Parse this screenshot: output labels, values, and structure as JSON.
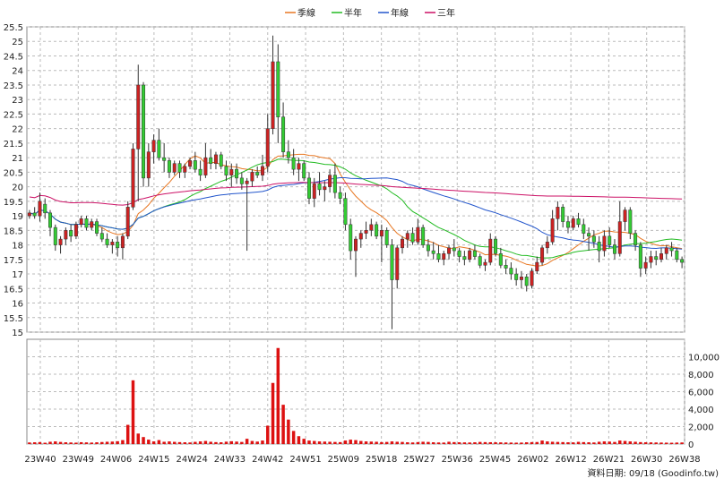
{
  "chart_data": {
    "type": "candlestick",
    "legend": [
      {
        "name": "季線",
        "color": "#e87722"
      },
      {
        "name": "半年",
        "color": "#22bb22"
      },
      {
        "name": "年線",
        "color": "#2255cc"
      },
      {
        "name": "三年",
        "color": "#cc1166"
      }
    ],
    "legend_position": "top-center",
    "grid": true,
    "price_axis": {
      "ylim": [
        15,
        25.5
      ],
      "ticks": [
        "15",
        "15.5",
        "16",
        "16.5",
        "17",
        "17.5",
        "18",
        "18.5",
        "19",
        "19.5",
        "20",
        "20.5",
        "21",
        "21.5",
        "22",
        "22.5",
        "23",
        "23.5",
        "24",
        "24.5",
        "25",
        "25.5"
      ]
    },
    "volume_axis": {
      "ylim": [
        0,
        12000
      ],
      "ticks": [
        "0",
        "2,000",
        "4,000",
        "6,000",
        "8,000",
        "10,000"
      ]
    },
    "x_ticks": [
      "23W40",
      "23W49",
      "24W06",
      "24W15",
      "24W24",
      "24W33",
      "24W42",
      "24W51",
      "25W09",
      "25W18",
      "25W27",
      "25W36",
      "25W45",
      "26W02",
      "26W12",
      "26W21",
      "26W30",
      "26W38"
    ],
    "footnote": "資料日期: 09/18  (Goodinfo.tw)",
    "up_color": "#cc2222",
    "down_color": "#33cc33",
    "candles": [
      [
        19.0,
        19.2,
        18.9,
        19.1
      ],
      [
        19.1,
        19.3,
        18.9,
        19.0
      ],
      [
        19.0,
        19.8,
        18.8,
        19.5
      ],
      [
        19.4,
        19.6,
        18.9,
        19.1
      ],
      [
        19.1,
        19.2,
        18.3,
        18.6
      ],
      [
        18.6,
        18.7,
        17.8,
        18.0
      ],
      [
        18.0,
        18.3,
        17.7,
        18.2
      ],
      [
        18.2,
        18.6,
        18.0,
        18.5
      ],
      [
        18.5,
        18.7,
        18.1,
        18.3
      ],
      [
        18.3,
        18.8,
        18.2,
        18.7
      ],
      [
        18.7,
        19.0,
        18.6,
        18.9
      ],
      [
        18.9,
        19.0,
        18.5,
        18.6
      ],
      [
        18.6,
        18.9,
        18.5,
        18.8
      ],
      [
        18.8,
        18.9,
        18.3,
        18.4
      ],
      [
        18.4,
        18.6,
        18.1,
        18.2
      ],
      [
        18.2,
        18.4,
        17.9,
        18.0
      ],
      [
        18.0,
        18.2,
        17.7,
        18.1
      ],
      [
        18.1,
        18.3,
        17.6,
        17.9
      ],
      [
        17.9,
        18.4,
        17.5,
        18.3
      ],
      [
        18.3,
        19.5,
        18.2,
        19.3
      ],
      [
        19.3,
        21.5,
        19.2,
        21.3
      ],
      [
        21.3,
        24.2,
        19.5,
        23.5
      ],
      [
        23.5,
        23.6,
        20.0,
        20.3
      ],
      [
        20.3,
        21.5,
        20.0,
        21.2
      ],
      [
        21.2,
        21.8,
        20.8,
        21.6
      ],
      [
        21.6,
        22.0,
        20.9,
        21.0
      ],
      [
        21.0,
        21.5,
        20.5,
        20.9
      ],
      [
        20.9,
        21.0,
        20.3,
        20.5
      ],
      [
        20.5,
        20.9,
        20.4,
        20.8
      ],
      [
        20.8,
        20.9,
        20.3,
        20.5
      ],
      [
        20.5,
        20.8,
        20.3,
        20.7
      ],
      [
        20.7,
        21.0,
        20.6,
        20.9
      ],
      [
        20.9,
        21.2,
        20.5,
        20.6
      ],
      [
        20.6,
        20.9,
        20.2,
        20.4
      ],
      [
        20.4,
        21.5,
        20.3,
        21.0
      ],
      [
        21.0,
        21.3,
        20.6,
        20.8
      ],
      [
        20.8,
        21.2,
        20.6,
        21.1
      ],
      [
        21.1,
        21.2,
        20.6,
        20.7
      ],
      [
        20.7,
        20.9,
        20.2,
        20.4
      ],
      [
        20.4,
        20.8,
        20.0,
        20.6
      ],
      [
        20.6,
        20.8,
        20.1,
        20.3
      ],
      [
        20.3,
        20.5,
        19.9,
        20.1
      ],
      [
        20.1,
        20.3,
        17.8,
        20.2
      ],
      [
        20.2,
        20.6,
        20.0,
        20.5
      ],
      [
        20.5,
        20.7,
        20.3,
        20.4
      ],
      [
        20.4,
        21.1,
        20.2,
        20.7
      ],
      [
        20.7,
        22.5,
        20.5,
        22.0
      ],
      [
        22.0,
        25.2,
        21.8,
        24.3
      ],
      [
        24.3,
        24.9,
        21.5,
        22.4
      ],
      [
        22.4,
        22.9,
        21.0,
        21.2
      ],
      [
        21.2,
        21.6,
        20.8,
        21.0
      ],
      [
        21.0,
        21.3,
        20.4,
        20.6
      ],
      [
        20.6,
        21.0,
        20.2,
        20.8
      ],
      [
        20.8,
        20.9,
        20.2,
        20.3
      ],
      [
        20.3,
        20.5,
        19.4,
        19.6
      ],
      [
        19.6,
        20.3,
        19.3,
        20.1
      ],
      [
        20.1,
        20.5,
        19.7,
        19.9
      ],
      [
        19.9,
        20.2,
        19.5,
        20.0
      ],
      [
        20.0,
        20.6,
        19.8,
        20.4
      ],
      [
        20.4,
        20.8,
        19.6,
        19.8
      ],
      [
        19.8,
        20.0,
        19.4,
        19.6
      ],
      [
        19.6,
        19.8,
        18.5,
        18.7
      ],
      [
        18.7,
        18.9,
        17.5,
        17.8
      ],
      [
        17.8,
        18.3,
        16.9,
        18.2
      ],
      [
        18.2,
        18.5,
        17.9,
        18.4
      ],
      [
        18.4,
        18.8,
        18.2,
        18.5
      ],
      [
        18.5,
        18.9,
        18.3,
        18.7
      ],
      [
        18.7,
        18.8,
        18.2,
        18.3
      ],
      [
        18.3,
        18.7,
        17.4,
        18.5
      ],
      [
        18.5,
        18.6,
        17.9,
        18.0
      ],
      [
        18.0,
        18.2,
        15.1,
        16.8
      ],
      [
        16.8,
        18.0,
        16.5,
        17.9
      ],
      [
        17.9,
        18.3,
        17.7,
        18.2
      ],
      [
        18.2,
        18.5,
        17.9,
        18.4
      ],
      [
        18.4,
        18.6,
        18.0,
        18.1
      ],
      [
        18.1,
        18.9,
        18.0,
        18.6
      ],
      [
        18.6,
        18.7,
        17.9,
        18.0
      ],
      [
        18.0,
        18.2,
        17.6,
        17.8
      ],
      [
        17.8,
        18.1,
        17.5,
        17.7
      ],
      [
        17.7,
        18.0,
        17.4,
        17.5
      ],
      [
        17.5,
        17.8,
        17.3,
        17.7
      ],
      [
        17.7,
        18.0,
        17.5,
        17.9
      ],
      [
        17.9,
        18.2,
        17.6,
        17.8
      ],
      [
        17.8,
        17.9,
        17.4,
        17.6
      ],
      [
        17.6,
        17.8,
        17.3,
        17.5
      ],
      [
        17.5,
        17.9,
        17.4,
        17.8
      ],
      [
        17.8,
        18.0,
        17.5,
        17.6
      ],
      [
        17.6,
        17.7,
        17.2,
        17.3
      ],
      [
        17.3,
        17.5,
        17.1,
        17.4
      ],
      [
        17.4,
        18.4,
        17.3,
        18.2
      ],
      [
        18.2,
        18.3,
        17.6,
        17.7
      ],
      [
        17.7,
        17.9,
        17.2,
        17.3
      ],
      [
        17.3,
        17.5,
        17.0,
        17.2
      ],
      [
        17.2,
        17.4,
        16.8,
        17.0
      ],
      [
        17.0,
        17.2,
        16.6,
        16.8
      ],
      [
        16.8,
        17.1,
        16.5,
        16.9
      ],
      [
        16.9,
        17.0,
        16.4,
        16.6
      ],
      [
        16.6,
        17.2,
        16.5,
        17.1
      ],
      [
        17.1,
        17.6,
        17.0,
        17.4
      ],
      [
        17.4,
        18.0,
        17.3,
        17.9
      ],
      [
        17.9,
        18.3,
        17.7,
        18.1
      ],
      [
        18.1,
        19.2,
        18.0,
        18.9
      ],
      [
        18.9,
        19.5,
        18.5,
        19.3
      ],
      [
        19.3,
        19.4,
        18.6,
        18.8
      ],
      [
        18.8,
        19.0,
        18.4,
        18.6
      ],
      [
        18.6,
        19.0,
        18.5,
        18.9
      ],
      [
        18.9,
        19.1,
        18.6,
        18.7
      ],
      [
        18.7,
        18.9,
        18.2,
        18.4
      ],
      [
        18.4,
        18.6,
        17.8,
        18.3
      ],
      [
        18.3,
        18.5,
        17.9,
        18.1
      ],
      [
        18.1,
        18.3,
        17.4,
        17.8
      ],
      [
        17.8,
        18.5,
        17.6,
        18.3
      ],
      [
        18.3,
        18.6,
        17.9,
        18.0
      ],
      [
        18.0,
        18.2,
        17.5,
        17.7
      ],
      [
        17.7,
        19.5,
        17.6,
        18.8
      ],
      [
        18.8,
        19.3,
        18.5,
        19.2
      ],
      [
        19.2,
        19.3,
        18.2,
        18.4
      ],
      [
        18.4,
        18.5,
        17.8,
        18.0
      ],
      [
        18.0,
        18.1,
        16.9,
        17.2
      ],
      [
        17.2,
        17.6,
        17.0,
        17.4
      ],
      [
        17.4,
        17.8,
        17.2,
        17.6
      ],
      [
        17.6,
        17.8,
        17.3,
        17.5
      ],
      [
        17.5,
        17.9,
        17.4,
        17.7
      ],
      [
        17.7,
        18.0,
        17.5,
        17.9
      ],
      [
        17.9,
        18.1,
        17.6,
        17.8
      ],
      [
        17.8,
        17.9,
        17.4,
        17.5
      ],
      [
        17.5,
        17.6,
        17.2,
        17.4
      ]
    ],
    "volumes": [
      180,
      200,
      220,
      150,
      260,
      300,
      240,
      200,
      180,
      160,
      210,
      190,
      170,
      200,
      230,
      260,
      280,
      320,
      450,
      2200,
      7300,
      1200,
      800,
      500,
      300,
      450,
      260,
      300,
      250,
      220,
      200,
      180,
      250,
      300,
      350,
      260,
      220,
      200,
      270,
      320,
      280,
      240,
      600,
      350,
      280,
      400,
      2100,
      7000,
      11000,
      4500,
      2800,
      1500,
      900,
      600,
      400,
      350,
      300,
      280,
      260,
      240,
      220,
      400,
      500,
      450,
      350,
      300,
      280,
      260,
      220,
      240,
      300,
      260,
      240,
      200,
      180,
      220,
      260,
      240,
      200,
      180,
      170,
      260,
      220,
      200,
      190,
      180,
      200,
      240,
      220,
      210,
      200,
      190,
      180,
      170,
      160,
      170,
      200,
      220,
      230,
      400,
      300,
      260,
      240,
      220,
      200,
      190,
      250,
      220,
      200,
      180,
      260,
      300,
      280,
      240,
      400,
      350,
      300,
      260,
      220,
      200,
      190,
      180,
      170,
      160,
      150,
      170,
      180
    ]
  }
}
